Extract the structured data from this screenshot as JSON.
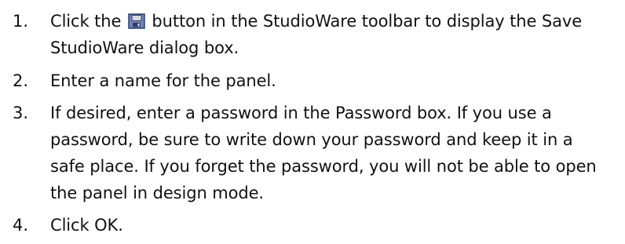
{
  "steps": [
    {
      "number": "1.",
      "text_before_icon": "Click the ",
      "icon": "save-disk-icon",
      "text_after_icon": " button in the StudioWare toolbar to display the Save StudioWare dialog box."
    },
    {
      "number": "2.",
      "text": "Enter a name for the panel."
    },
    {
      "number": "3.",
      "text": "If desired, enter a password in the Password box. If you use a password, be sure to write down your password and keep it in a safe place. If you forget the password, you will not be able to open the panel in design mode."
    },
    {
      "number": "4.",
      "text": "Click OK."
    }
  ],
  "colors": {
    "text": "#111111",
    "icon_border": "#2a3f6f",
    "icon_fill": "#6f86b6",
    "icon_label": "#d8d8d8",
    "background": "#ffffff"
  }
}
